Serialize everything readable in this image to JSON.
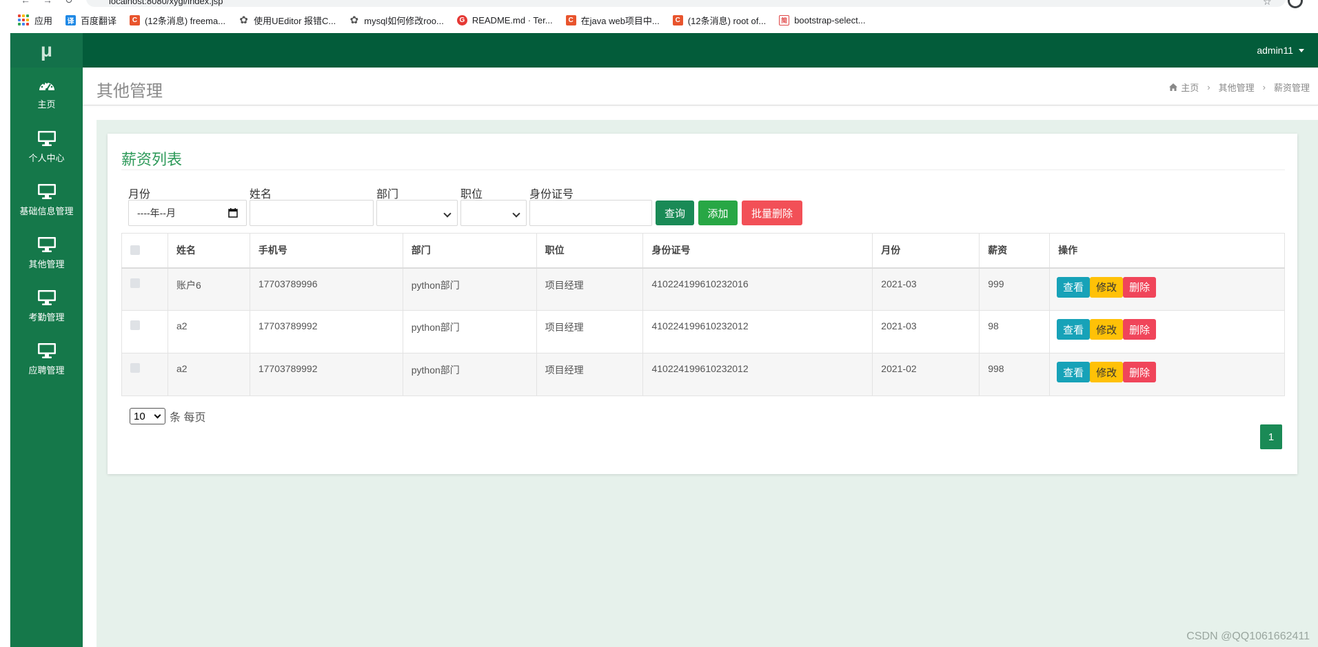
{
  "browser": {
    "url": "localhost:8080/xygl/index.jsp",
    "bookmarks": [
      {
        "label": "应用",
        "icon": "apps-grid-icon"
      },
      {
        "label": "百度翻译",
        "icon": "translate-icon"
      },
      {
        "label": "(12条消息) freema...",
        "icon": "csdn-icon"
      },
      {
        "label": "使用UEditor 报错C...",
        "icon": "website-icon"
      },
      {
        "label": "mysql如何修改roo...",
        "icon": "website-icon"
      },
      {
        "label": "README.md · Ter...",
        "icon": "gitee-icon"
      },
      {
        "label": "在java web项目中...",
        "icon": "csdn-icon"
      },
      {
        "label": "(12条消息) root of...",
        "icon": "csdn-icon"
      },
      {
        "label": "bootstrap-select...",
        "icon": "jianshu-icon"
      }
    ]
  },
  "sidebar": {
    "logo": "μ",
    "items": [
      {
        "label": "主页",
        "icon": "dashboard-icon"
      },
      {
        "label": "个人中心",
        "icon": "monitor-icon"
      },
      {
        "label": "基础信息管理",
        "icon": "monitor-icon"
      },
      {
        "label": "其他管理",
        "icon": "monitor-icon"
      },
      {
        "label": "考勤管理",
        "icon": "monitor-icon"
      },
      {
        "label": "应聘管理",
        "icon": "monitor-icon"
      }
    ]
  },
  "header": {
    "user": "admin11"
  },
  "page": {
    "title": "其他管理",
    "breadcrumb": [
      "主页",
      "其他管理",
      "薪资管理"
    ]
  },
  "card": {
    "title": "薪资列表"
  },
  "filters": {
    "month_label": "月份",
    "month_value": "----年--月",
    "name_label": "姓名",
    "dept_label": "部门",
    "position_label": "职位",
    "idcard_label": "身份证号",
    "query_button": "查询",
    "add_button": "添加",
    "batch_delete_button": "批量删除"
  },
  "table": {
    "columns": [
      "姓名",
      "手机号",
      "部门",
      "职位",
      "身份证号",
      "月份",
      "薪资",
      "操作"
    ],
    "rows": [
      {
        "name": "账户6",
        "phone": "17703789996",
        "dept": "python部门",
        "position": "项目经理",
        "idcard": "410224199610232016",
        "month": "2021-03",
        "salary": "999"
      },
      {
        "name": "a2",
        "phone": "17703789992",
        "dept": "python部门",
        "position": "项目经理",
        "idcard": "410224199610232012",
        "month": "2021-03",
        "salary": "98"
      },
      {
        "name": "a2",
        "phone": "17703789992",
        "dept": "python部门",
        "position": "项目经理",
        "idcard": "410224199610232012",
        "month": "2021-02",
        "salary": "998"
      }
    ],
    "actions": {
      "view": "查看",
      "edit": "修改",
      "delete": "删除"
    }
  },
  "pagination": {
    "page_size": "10",
    "page_size_suffix": "条 每页",
    "current_page": "1"
  },
  "watermark": "CSDN @QQ1061662411",
  "colors": {
    "sidebar": "#15784a",
    "header": "#035c3a",
    "accent": "#1a8a56",
    "title_green": "#2e9a5a"
  }
}
